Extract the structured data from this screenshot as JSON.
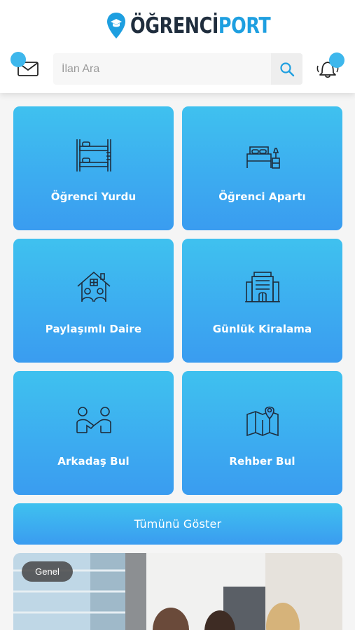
{
  "header": {
    "logo_part1": "ÖĞRENCİ",
    "logo_part2": "PORT",
    "search_placeholder": "İlan Ara"
  },
  "categories": [
    {
      "label": "Öğrenci Yurdu",
      "icon": "bunk-bed-icon"
    },
    {
      "label": "Öğrenci Apartı",
      "icon": "bed-icon"
    },
    {
      "label": "Paylaşımlı Daire",
      "icon": "shared-house-icon"
    },
    {
      "label": "Günlük Kiralama",
      "icon": "building-icon"
    },
    {
      "label": "Arkadaş Bul",
      "icon": "friends-icon"
    },
    {
      "label": "Rehber Bul",
      "icon": "map-pin-icon"
    }
  ],
  "show_all_label": "Tümünü Göster",
  "featured": {
    "badge": "Genel"
  },
  "colors": {
    "accent": "#3eb7ec",
    "tile_top": "#3fc1ef",
    "tile_bottom": "#3a9cf0",
    "logo_dark": "#1f2d3d",
    "logo_blue": "#1e9fe0"
  }
}
